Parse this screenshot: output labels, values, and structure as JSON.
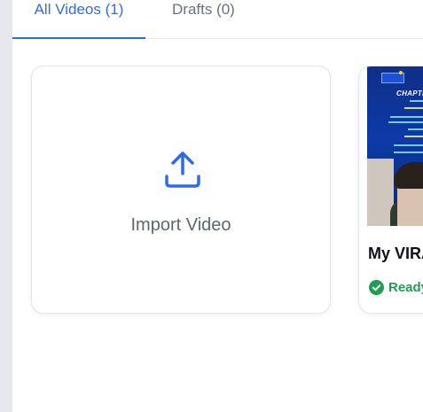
{
  "tabs": [
    {
      "label": "All Videos (1)",
      "active": true
    },
    {
      "label": "Drafts (0)",
      "active": false
    }
  ],
  "import_card": {
    "label": "Import Video",
    "icon": "upload-icon"
  },
  "videos": [
    {
      "title": "My VIRA",
      "status": "Ready",
      "status_icon": "check-circle-icon",
      "thumbnail_heading": "CHAPTE"
    }
  ],
  "colors": {
    "accent": "#2f6be8",
    "ready": "#1f9d55",
    "rail": "#e7e8ee"
  }
}
